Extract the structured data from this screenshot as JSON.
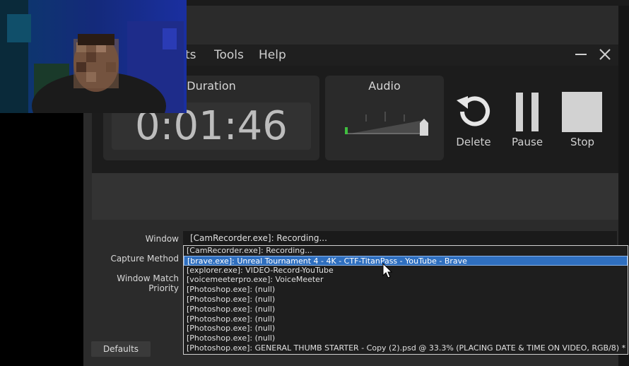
{
  "recorder": {
    "menu": [
      "ts",
      "Tools",
      "Help"
    ],
    "duration_title": "Duration",
    "duration_value": "0:01:46",
    "audio_title": "Audio",
    "delete_label": "Delete",
    "pause_label": "Pause",
    "stop_label": "Stop"
  },
  "form": {
    "window_label": "Window",
    "window_value": "[CamRecorder.exe]: Recording...",
    "capture_method_label": "Capture Method",
    "match_priority_label": "Window Match Priority",
    "defaults_label": "Defaults"
  },
  "dropdown": {
    "selected_index": 1,
    "items": [
      "[CamRecorder.exe]: Recording...",
      "[brave.exe]: Unreal Tournament 4 - 4K - CTF-TitanPass - YouTube - Brave",
      "[explorer.exe]: VIDEO-Record-YouTube",
      "[voicemeeterpro.exe]: VoiceMeeter",
      "[Photoshop.exe]: (null)",
      "[Photoshop.exe]: (null)",
      "[Photoshop.exe]: (null)",
      "[Photoshop.exe]: (null)",
      "[Photoshop.exe]: (null)",
      "[Photoshop.exe]: (null)",
      "[Photoshop.exe]: GENERAL THUMB STARTER - Copy (2).psd @ 33.3% (PLACING DATE & TIME ON VIDEO, RGB/8) *"
    ]
  },
  "colors": {
    "panel_bg": "#2b2b2b",
    "recorder_bg": "#1c1c1c",
    "selection_bg": "#2f6fbf",
    "audio_meter": "#3fbf3f",
    "stop_button": "#d2d2d2"
  },
  "icons": [
    "minimize-icon",
    "close-icon",
    "delete-icon",
    "pause-icon",
    "stop-icon",
    "mouse-cursor-icon"
  ]
}
